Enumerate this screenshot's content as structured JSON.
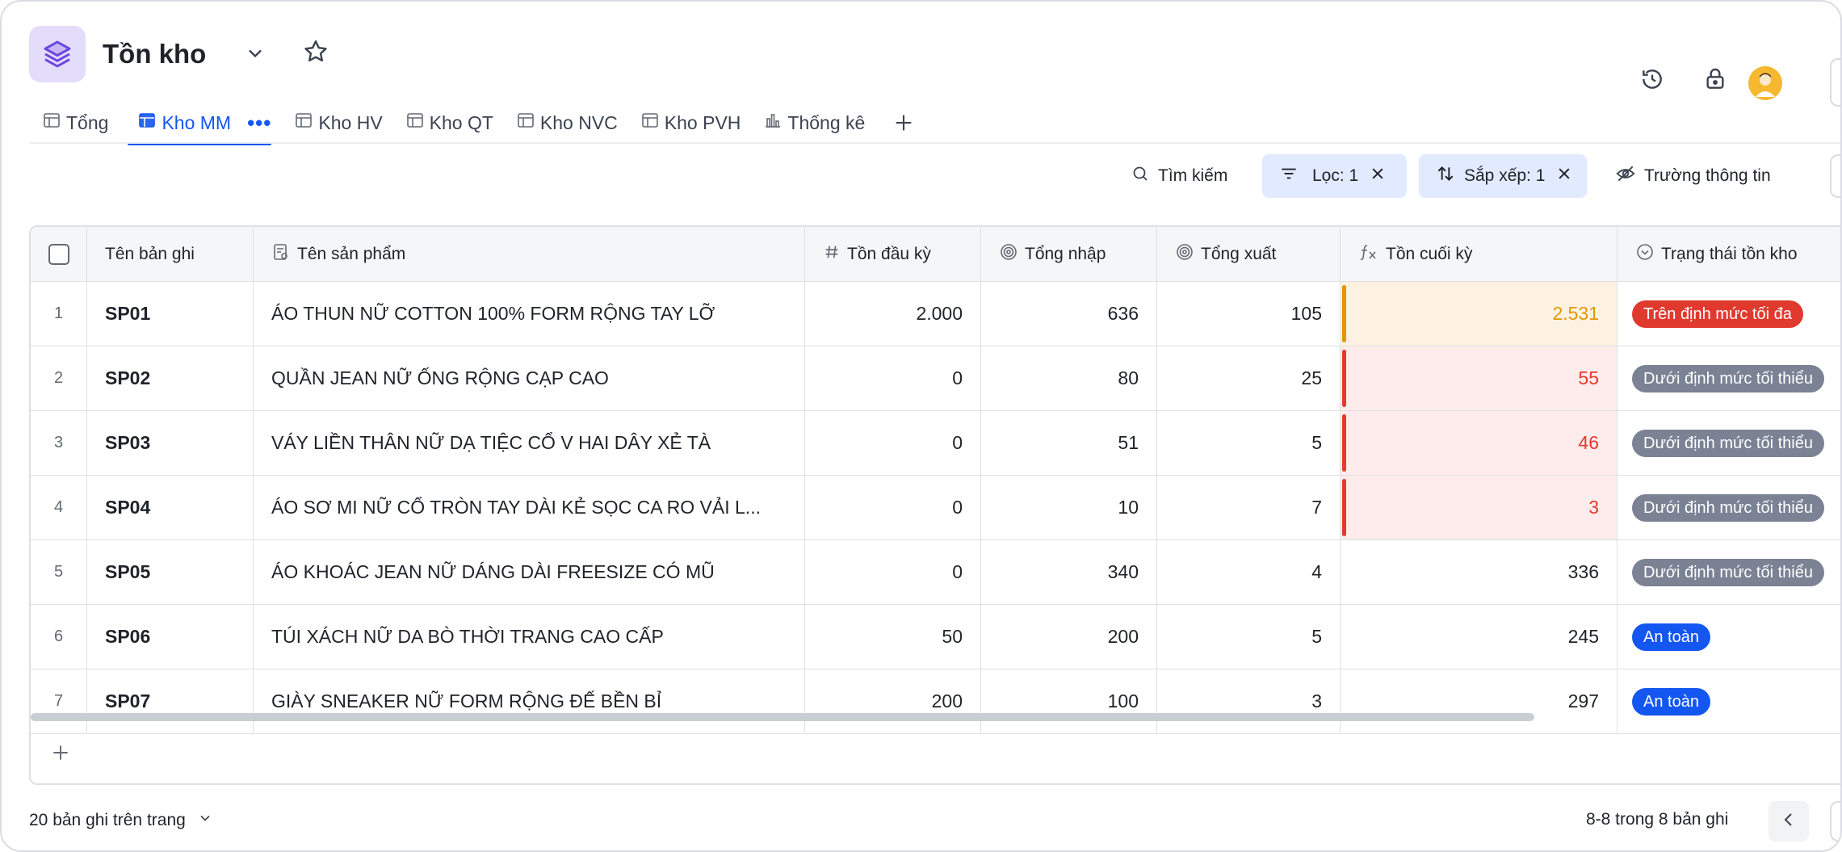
{
  "header": {
    "title": "Tồn kho"
  },
  "tabs": [
    {
      "label": "Tổng",
      "icon": "table-icon",
      "active": false
    },
    {
      "label": "Kho MM",
      "icon": "table-icon",
      "active": true
    },
    {
      "label": "Kho HV",
      "icon": "table-icon",
      "active": false
    },
    {
      "label": "Kho QT",
      "icon": "table-icon",
      "active": false
    },
    {
      "label": "Kho NVC",
      "icon": "table-icon",
      "active": false
    },
    {
      "label": "Kho PVH",
      "icon": "table-icon",
      "active": false
    },
    {
      "label": "Thống kê",
      "icon": "bar-chart-icon",
      "active": false
    }
  ],
  "tab_more": "•••",
  "toolbar": {
    "search_label": "Tìm kiếm",
    "filter_label": "Lọc: 1",
    "sort_label": "Sắp xếp: 1",
    "fields_label": "Trường thông tin"
  },
  "table": {
    "columns": [
      {
        "label": "Tên bản ghi",
        "icon": ""
      },
      {
        "label": "Tên sản phẩm",
        "icon": "text-field-icon"
      },
      {
        "label": "Tồn đầu kỳ",
        "icon": "hash-icon"
      },
      {
        "label": "Tổng nhập",
        "icon": "rollup-icon"
      },
      {
        "label": "Tổng xuất",
        "icon": "rollup-icon"
      },
      {
        "label": "Tồn cuối kỳ",
        "icon": "formula-icon"
      },
      {
        "label": "Trạng thái tồn kho",
        "icon": "single-select-icon"
      }
    ],
    "rows": [
      {
        "n": "1",
        "code": "SP01",
        "name": "ÁO THUN NỮ COTTON 100% FORM RỘNG TAY LỠ",
        "opening": "2.000",
        "in": "636",
        "out": "105",
        "closing": "2.531",
        "highlight": "orange",
        "status": "Trên định mức tối đa",
        "status_color": "#e03a2f"
      },
      {
        "n": "2",
        "code": "SP02",
        "name": "QUẦN JEAN NỮ ỐNG RỘNG CẠP CAO",
        "opening": "0",
        "in": "80",
        "out": "25",
        "closing": "55",
        "highlight": "red",
        "status": "Dưới định mức tối thiểu",
        "status_color": "#7a8294"
      },
      {
        "n": "3",
        "code": "SP03",
        "name": "VÁY LIỀN THÂN NỮ DẠ TIỆC CỔ V HAI DÂY XẺ TÀ",
        "opening": "0",
        "in": "51",
        "out": "5",
        "closing": "46",
        "highlight": "red",
        "status": "Dưới định mức tối thiểu",
        "status_color": "#7a8294"
      },
      {
        "n": "4",
        "code": "SP04",
        "name": "ÁO SƠ MI NỮ CỔ TRÒN TAY DÀI KẺ SỌC CA RO VẢI L...",
        "opening": "0",
        "in": "10",
        "out": "7",
        "closing": "3",
        "highlight": "red",
        "status": "Dưới định mức tối thiểu",
        "status_color": "#7a8294"
      },
      {
        "n": "5",
        "code": "SP05",
        "name": "ÁO KHOÁC JEAN NỮ DÁNG DÀI FREESIZE CÓ MŨ",
        "opening": "0",
        "in": "340",
        "out": "4",
        "closing": "336",
        "highlight": "none",
        "status": "Dưới định mức tối thiểu",
        "status_color": "#7a8294"
      },
      {
        "n": "6",
        "code": "SP06",
        "name": "TÚI XÁCH NỮ DA BÒ THỜI TRANG CAO CẤP",
        "opening": "50",
        "in": "200",
        "out": "5",
        "closing": "245",
        "highlight": "none",
        "status": "An toàn",
        "status_color": "#1456f0"
      },
      {
        "n": "7",
        "code": "SP07",
        "name": "GIÀY SNEAKER NỮ FORM RỘNG ĐẾ BỀN BỈ",
        "opening": "200",
        "in": "100",
        "out": "3",
        "closing": "297",
        "highlight": "none",
        "status": "An toàn",
        "status_color": "#1456f0"
      }
    ]
  },
  "footer": {
    "page_size_label": "20 bản ghi trên trang",
    "range_label": "8-8 trong 8 bản ghi"
  },
  "colors": {
    "accent": "#1456f0",
    "app_icon_bg": "#e4dcfb",
    "filter_bg": "#e1eaff",
    "danger": "#e53a2e",
    "warning": "#e69500"
  }
}
